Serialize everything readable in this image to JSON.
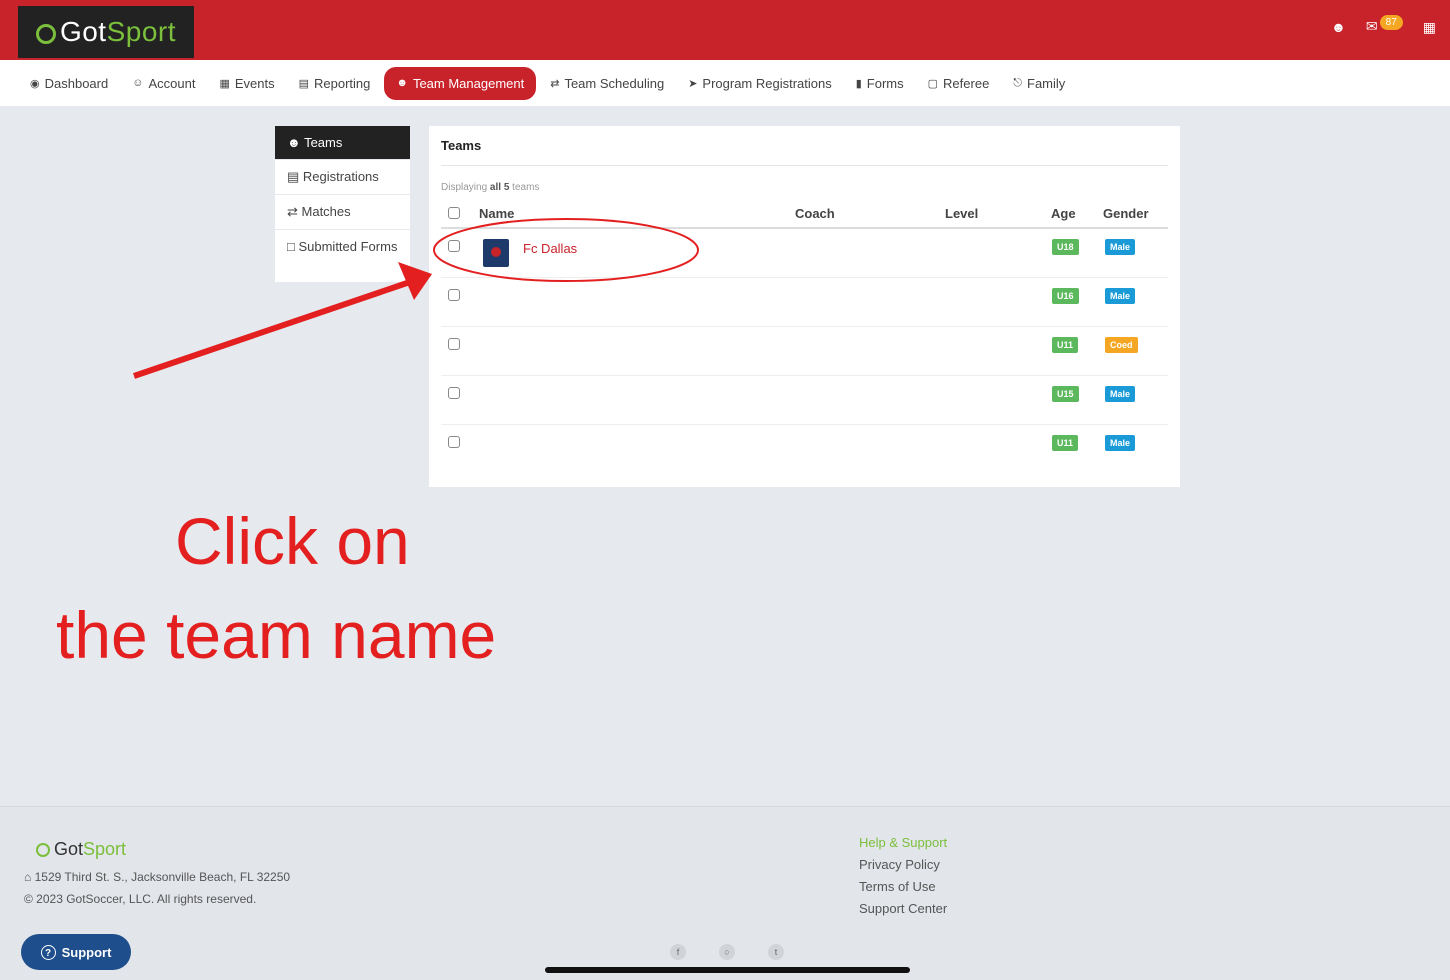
{
  "topbar": {
    "logo_prefix": "Got",
    "logo_suffix": "Sport",
    "user_icon": "user-icon",
    "message_count": "87",
    "apps_icon": "grid-icon"
  },
  "nav": [
    {
      "label": "Dashboard",
      "icon": "dashboard-icon"
    },
    {
      "label": "Account",
      "icon": "account-icon"
    },
    {
      "label": "Events",
      "icon": "calendar-icon"
    },
    {
      "label": "Reporting",
      "icon": "report-icon"
    },
    {
      "label": "Team Management",
      "icon": "users-icon",
      "active": true
    },
    {
      "label": "Team Scheduling",
      "icon": "exchange-icon"
    },
    {
      "label": "Program Registrations",
      "icon": "send-icon"
    },
    {
      "label": "Forms",
      "icon": "file-icon"
    },
    {
      "label": "Referee",
      "icon": "calendar-icon"
    },
    {
      "label": "Family",
      "icon": "sitemap-icon"
    }
  ],
  "sidebar": [
    {
      "label": "Teams",
      "active": true
    },
    {
      "label": "Registrations"
    },
    {
      "label": "Matches"
    },
    {
      "label": "Submitted Forms"
    }
  ],
  "panel": {
    "title": "Teams",
    "displaying_prefix": "Displaying",
    "displaying_strong": "all 5",
    "displaying_suffix": "teams",
    "columns": {
      "name": "Name",
      "coach": "Coach",
      "level": "Level",
      "age": "Age",
      "gender": "Gender"
    },
    "rows": [
      {
        "name": "Fc Dallas",
        "age": "U18",
        "gender": "Male"
      },
      {
        "name": "",
        "age": "U16",
        "gender": "Male"
      },
      {
        "name": "",
        "age": "U11",
        "gender": "Coed"
      },
      {
        "name": "",
        "age": "U15",
        "gender": "Male"
      },
      {
        "name": "",
        "age": "U11",
        "gender": "Male"
      }
    ]
  },
  "colors": {
    "brand_red": "#c8222a",
    "green": "#5cb85c",
    "blue": "#1a9bd7",
    "orange": "#f5a623",
    "annotation": "#e3201f"
  },
  "annotation": {
    "line1": "Click on",
    "line2": "the team name"
  },
  "footer": {
    "logo_prefix": "Got",
    "logo_suffix": "Sport",
    "address": "1529 Third St. S., Jacksonville Beach, FL 32250",
    "copyright": "© 2023 GotSoccer, LLC. All rights reserved.",
    "links": [
      "Help & Support",
      "Privacy Policy",
      "Terms of Use",
      "Support Center"
    ],
    "support_label": "Support",
    "social_icons": [
      "facebook-icon",
      "instagram-icon",
      "twitter-icon"
    ]
  }
}
